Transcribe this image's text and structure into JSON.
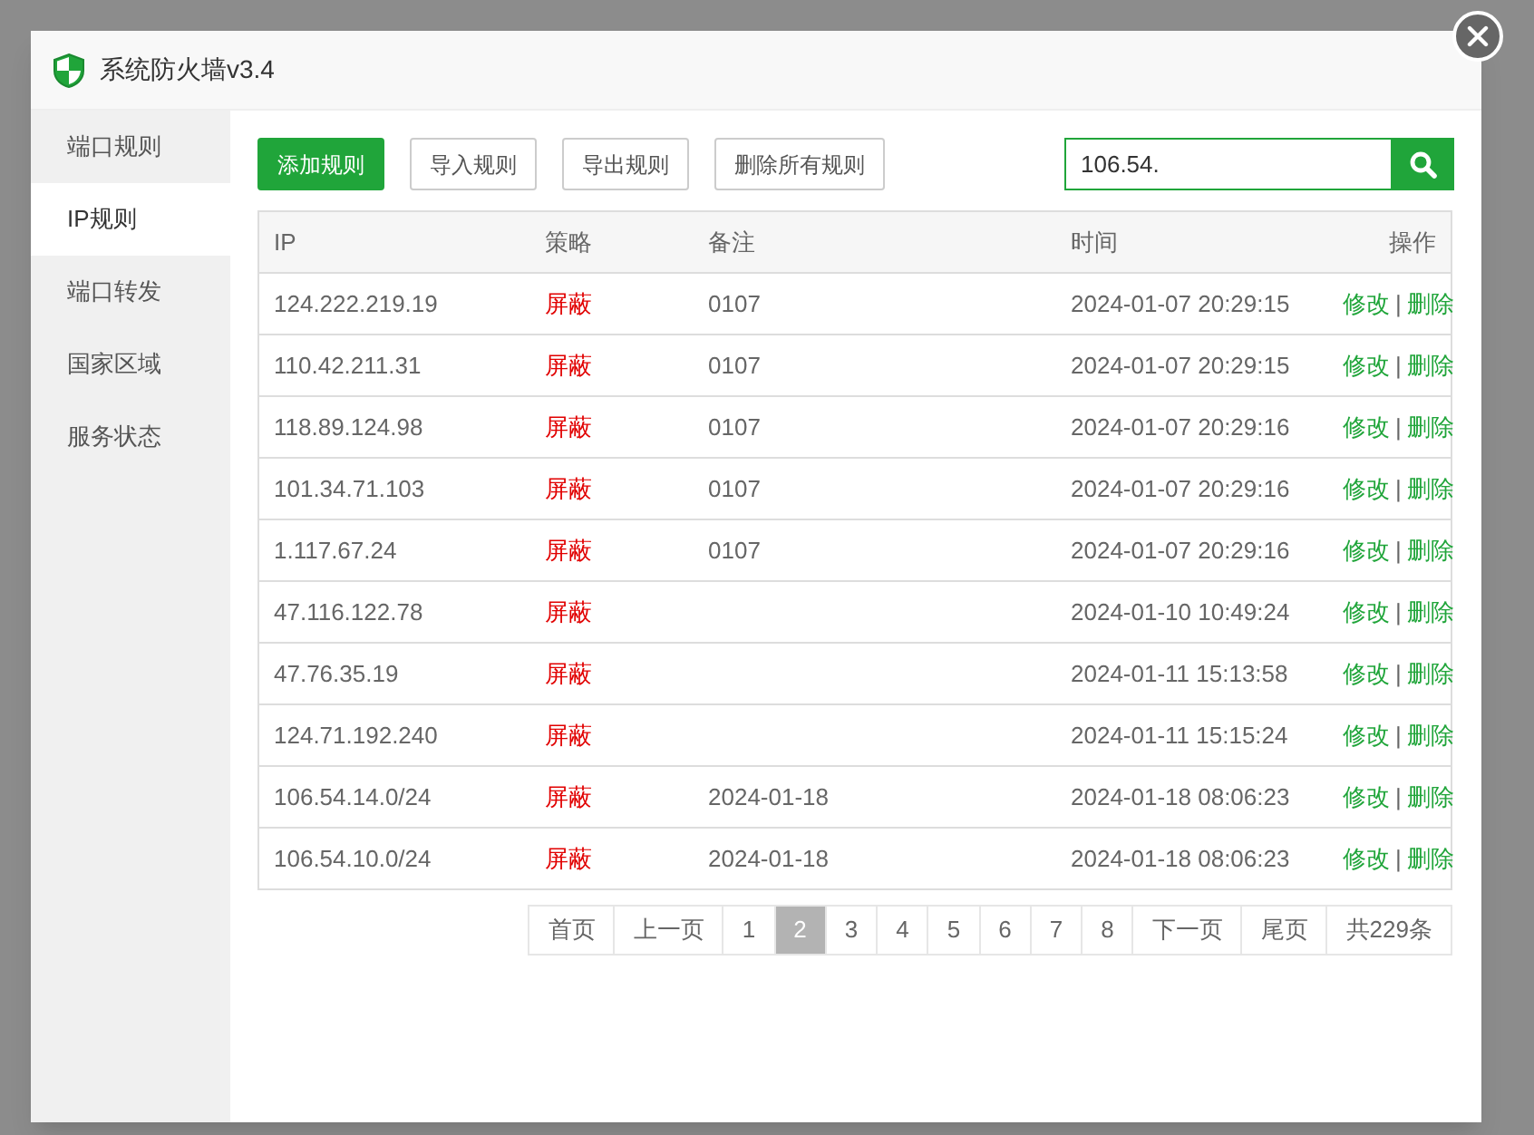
{
  "window": {
    "title": "系统防火墙v3.4"
  },
  "sidebar": {
    "items": [
      {
        "label": "端口规则",
        "selected": false
      },
      {
        "label": "IP规则",
        "selected": true
      },
      {
        "label": "端口转发",
        "selected": false
      },
      {
        "label": "国家区域",
        "selected": false
      },
      {
        "label": "服务状态",
        "selected": false
      }
    ]
  },
  "toolbar": {
    "buttons": [
      {
        "label": "添加规则",
        "kind": "primary"
      },
      {
        "label": "导入规则",
        "kind": "default"
      },
      {
        "label": "导出规则",
        "kind": "default"
      },
      {
        "label": "删除所有规则",
        "kind": "default"
      }
    ],
    "search": {
      "value": "106.54."
    }
  },
  "table": {
    "columns": [
      "IP",
      "策略",
      "备注",
      "时间",
      "操作"
    ],
    "rows": [
      {
        "ip": "124.222.219.19",
        "policy": "屏蔽",
        "note": "0107",
        "time": "2024-01-07 20:29:15",
        "edit": "修改",
        "sep": "|",
        "delete": "删除"
      },
      {
        "ip": "110.42.211.31",
        "policy": "屏蔽",
        "note": "0107",
        "time": "2024-01-07 20:29:15",
        "edit": "修改",
        "sep": "|",
        "delete": "删除"
      },
      {
        "ip": "118.89.124.98",
        "policy": "屏蔽",
        "note": "0107",
        "time": "2024-01-07 20:29:16",
        "edit": "修改",
        "sep": "|",
        "delete": "删除"
      },
      {
        "ip": "101.34.71.103",
        "policy": "屏蔽",
        "note": "0107",
        "time": "2024-01-07 20:29:16",
        "edit": "修改",
        "sep": "|",
        "delete": "删除"
      },
      {
        "ip": "1.117.67.24",
        "policy": "屏蔽",
        "note": "0107",
        "time": "2024-01-07 20:29:16",
        "edit": "修改",
        "sep": "|",
        "delete": "删除"
      },
      {
        "ip": "47.116.122.78",
        "policy": "屏蔽",
        "time": "2024-01-10 10:49:24",
        "edit": "修改",
        "sep": "|",
        "delete": "删除"
      },
      {
        "ip": "47.76.35.19",
        "policy": "屏蔽",
        "time": "2024-01-11 15:13:58",
        "edit": "修改",
        "sep": "|",
        "delete": "删除"
      },
      {
        "ip": "124.71.192.240",
        "policy": "屏蔽",
        "time": "2024-01-11 15:15:24",
        "edit": "修改",
        "sep": "|",
        "delete": "删除"
      },
      {
        "ip": "106.54.14.0/24",
        "policy": "屏蔽",
        "note": "2024-01-18",
        "time": "2024-01-18 08:06:23",
        "edit": "修改",
        "sep": "|",
        "delete": "删除"
      },
      {
        "ip": "106.54.10.0/24",
        "policy": "屏蔽",
        "note": "2024-01-18",
        "time": "2024-01-18 08:06:23",
        "edit": "修改",
        "sep": "|",
        "delete": "删除"
      }
    ]
  },
  "pagination": {
    "items": [
      {
        "label": "首页",
        "selected": false
      },
      {
        "label": "上一页",
        "selected": false
      },
      {
        "label": "1",
        "selected": false
      },
      {
        "label": "2",
        "selected": true
      },
      {
        "label": "3",
        "selected": false
      },
      {
        "label": "4",
        "selected": false
      },
      {
        "label": "5",
        "selected": false
      },
      {
        "label": "6",
        "selected": false
      },
      {
        "label": "7",
        "selected": false
      },
      {
        "label": "8",
        "selected": false
      },
      {
        "label": "下一页",
        "selected": false
      },
      {
        "label": "尾页",
        "selected": false
      }
    ],
    "total": "共229条"
  }
}
